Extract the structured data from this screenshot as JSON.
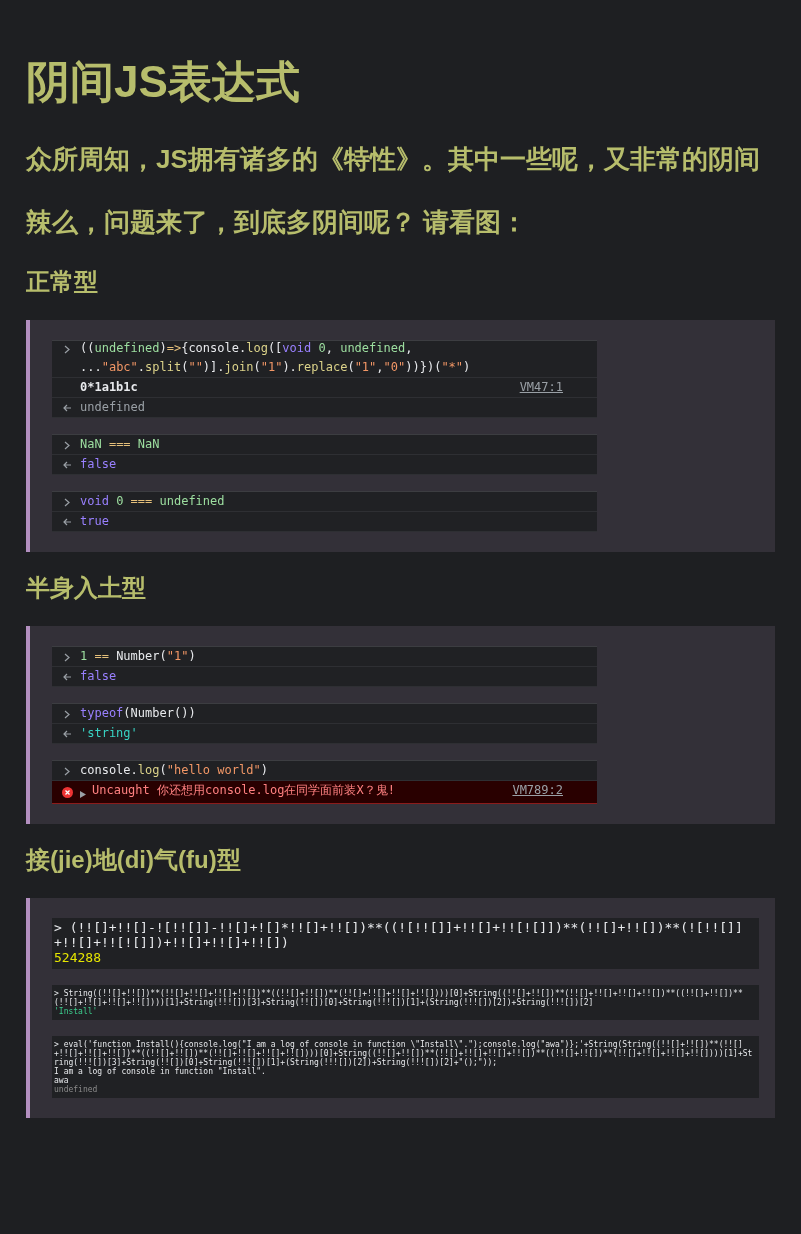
{
  "title": "阴间JS表达式",
  "intro": [
    "众所周知，JS拥有诸多的《特性》。其中一些呢，又非常的阴间",
    "辣么，问题来了，到底多阴间呢？ 请看图："
  ],
  "sections": [
    {
      "heading": "正常型",
      "kind": "console",
      "panels": [
        {
          "lines": [
            {
              "kind": "input",
              "parts": [
                {
                  "kind": "plain",
                  "text": "(("
                },
                {
                  "kind": "name",
                  "text": "undefined"
                },
                {
                  "kind": "plain",
                  "text": ")"
                },
                {
                  "kind": "op",
                  "text": "=>"
                },
                {
                  "kind": "plain",
                  "text": "{console."
                },
                {
                  "kind": "fn",
                  "text": "log"
                },
                {
                  "kind": "plain",
                  "text": "(["
                },
                {
                  "kind": "keyword",
                  "text": "void"
                },
                {
                  "kind": "name",
                  "text": " 0"
                },
                {
                  "kind": "plain",
                  "text": ", "
                },
                {
                  "kind": "name",
                  "text": "undefined"
                },
                {
                  "kind": "plain",
                  "text": ","
                }
              ]
            },
            {
              "kind": "continuation",
              "parts": [
                {
                  "kind": "plain",
                  "text": "..."
                },
                {
                  "kind": "string",
                  "text": "\"abc\""
                },
                {
                  "kind": "plain",
                  "text": "."
                },
                {
                  "kind": "fn",
                  "text": "split"
                },
                {
                  "kind": "plain",
                  "text": "("
                },
                {
                  "kind": "string",
                  "text": "\"\""
                },
                {
                  "kind": "plain",
                  "text": ")]."
                },
                {
                  "kind": "fn",
                  "text": "join"
                },
                {
                  "kind": "plain",
                  "text": "("
                },
                {
                  "kind": "string",
                  "text": "\"1\""
                },
                {
                  "kind": "plain",
                  "text": ")."
                },
                {
                  "kind": "fn",
                  "text": "replace"
                },
                {
                  "kind": "plain",
                  "text": "("
                },
                {
                  "kind": "string",
                  "text": "\"1\""
                },
                {
                  "kind": "plain",
                  "text": ","
                },
                {
                  "kind": "string",
                  "text": "\"0\""
                },
                {
                  "kind": "plain",
                  "text": "))})("
                },
                {
                  "kind": "string",
                  "text": "\"*\""
                },
                {
                  "kind": "plain",
                  "text": ")"
                }
              ]
            },
            {
              "kind": "log",
              "text": "0*1a1b1c",
              "source": "VM47:1"
            },
            {
              "kind": "result",
              "parts": [
                {
                  "kind": "muted",
                  "text": "undefined"
                }
              ]
            }
          ]
        },
        {
          "lines": [
            {
              "kind": "input",
              "parts": [
                {
                  "kind": "name",
                  "text": "NaN"
                },
                {
                  "kind": "op",
                  "text": " === "
                },
                {
                  "kind": "name",
                  "text": "NaN"
                }
              ]
            },
            {
              "kind": "result",
              "parts": [
                {
                  "kind": "bool",
                  "text": "false"
                }
              ]
            }
          ]
        },
        {
          "lines": [
            {
              "kind": "input",
              "parts": [
                {
                  "kind": "keyword",
                  "text": "void"
                },
                {
                  "kind": "name",
                  "text": " 0"
                },
                {
                  "kind": "op",
                  "text": " === "
                },
                {
                  "kind": "name",
                  "text": "undefined"
                }
              ]
            },
            {
              "kind": "result",
              "parts": [
                {
                  "kind": "bool",
                  "text": "true"
                }
              ]
            }
          ]
        }
      ]
    },
    {
      "heading": "半身入土型",
      "kind": "console",
      "panels": [
        {
          "lines": [
            {
              "kind": "input",
              "parts": [
                {
                  "kind": "name",
                  "text": "1"
                },
                {
                  "kind": "op",
                  "text": " == "
                },
                {
                  "kind": "plain",
                  "text": "Number("
                },
                {
                  "kind": "string",
                  "text": "\"1\""
                },
                {
                  "kind": "plain",
                  "text": ")"
                }
              ]
            },
            {
              "kind": "result",
              "parts": [
                {
                  "kind": "bool",
                  "text": "false"
                }
              ]
            }
          ]
        },
        {
          "lines": [
            {
              "kind": "input",
              "parts": [
                {
                  "kind": "keyword",
                  "text": "typeof"
                },
                {
                  "kind": "plain",
                  "text": "(Number())"
                }
              ]
            },
            {
              "kind": "result",
              "parts": [
                {
                  "kind": "str",
                  "text": "'string'"
                }
              ]
            }
          ]
        },
        {
          "lines": [
            {
              "kind": "input",
              "parts": [
                {
                  "kind": "plain",
                  "text": "console."
                },
                {
                  "kind": "fn",
                  "text": "log"
                },
                {
                  "kind": "plain",
                  "text": "("
                },
                {
                  "kind": "string",
                  "text": "\"hello world\""
                },
                {
                  "kind": "plain",
                  "text": ")"
                }
              ]
            },
            {
              "kind": "error",
              "text": "Uncaught 你还想用console.log在同学面前装X？鬼!",
              "source": "VM789:2"
            }
          ]
        }
      ]
    },
    {
      "heading": "接(jie)地(di)气(fu)型",
      "kind": "screenshot",
      "panels": [
        {
          "kind": "large",
          "lines": [
            {
              "kind": "input",
              "text": "> (!![]+!![]-![!![]]-!![]+![]*!![]+!![])**((![!![]]+!![]+!![![]])**(!![]+!![])**(![!![]]+!![]+!![![]])+!![]+!![]+!![])"
            },
            {
              "kind": "number",
              "text": "524288"
            }
          ]
        },
        {
          "kind": "small",
          "lines": [
            {
              "kind": "input",
              "text": "> String((!![]+!![])**(!![]+!![]+!![]+!![])**((!![]+!![])**(!![]+!![]+!![]+!![])))[0]+String((!![]+!![])**(!![]+!![]+!![]+!![])**((!![]+!![])**(!![]+!![]+!![]+!![])))[1]+String(!!![])[3]+String(!![])[0]+String(!!![])[1]+(String(!!![])[2])+String(!!![])[2]"
            },
            {
              "kind": "string",
              "text": "'Install'"
            }
          ]
        },
        {
          "kind": "small",
          "lines": [
            {
              "kind": "input",
              "text": "> eval('function Install(){console.log(\"I am a log of console in function \\\"Install\\\".\");console.log(\"awa\")};'+String(String((!![]+!![])**(!![]+!![]+!![]+!![])**((!![]+!![])**(!![]+!![]+!![]+!![])))[0]+String((!![]+!![])**(!![]+!![]+!![]+!![])**((!![]+!![])**(!![]+!![]+!![]+!![])))[1]+String(!!![])[3]+String(!![])[0]+String(!!![])[1]+(String(!!![])[2])+String(!!![])[2]+\"();\"));"
            },
            {
              "kind": "log",
              "text": "I am a log of console in function \"Install\"."
            },
            {
              "kind": "log",
              "text": "awa"
            },
            {
              "kind": "muted",
              "text": "undefined"
            }
          ]
        }
      ]
    }
  ]
}
